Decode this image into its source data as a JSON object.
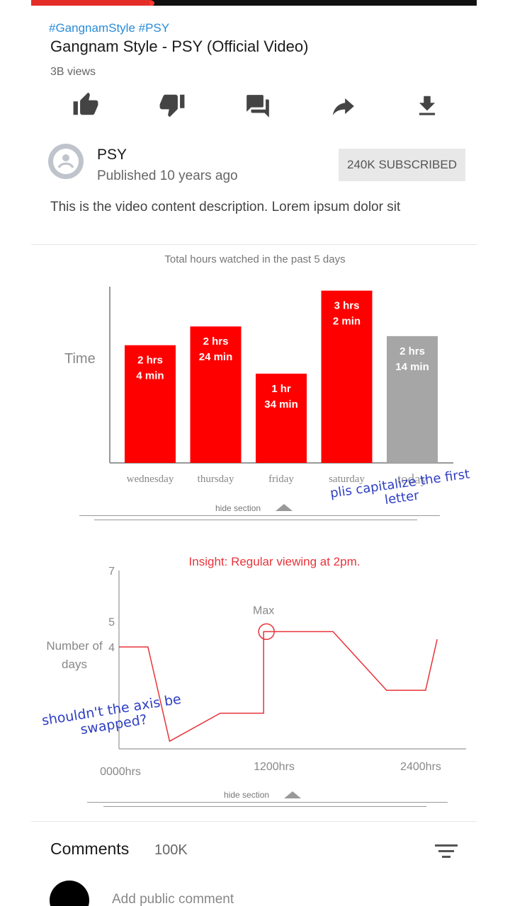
{
  "player": {
    "progress": 0.27,
    "accent": "#e52d27"
  },
  "video": {
    "hashtags": "#GangnamStyle #PSY",
    "title": "Gangnam Style - PSY (Official Video)",
    "views": "3B views",
    "description": "This is the video content description. Lorem ipsum dolor sit"
  },
  "actions": [
    {
      "name": "like-icon"
    },
    {
      "name": "dislike-icon"
    },
    {
      "name": "comment-icon"
    },
    {
      "name": "share-icon"
    },
    {
      "name": "download-icon"
    }
  ],
  "channel": {
    "name": "PSY",
    "published": "Published 10 years ago",
    "subscribe_label": "240K SUBSCRIBED"
  },
  "chart_data": [
    {
      "type": "bar",
      "title": "Total hours watched in the past 5 days",
      "ylabel": "Time",
      "categories": [
        "wednesday",
        "thursday",
        "friday",
        "saturday",
        "today"
      ],
      "values": [
        2.07,
        2.4,
        1.57,
        3.03,
        2.23
      ],
      "value_labels": [
        [
          "2 hrs",
          "4 min"
        ],
        [
          "2 hrs",
          "24 min"
        ],
        [
          "1 hr",
          "34 min"
        ],
        [
          "3 hrs",
          "2 min"
        ],
        [
          "2 hrs",
          "14 min"
        ]
      ],
      "colors": [
        "#ff0000",
        "#ff0000",
        "#ff0000",
        "#ff0000",
        "#a6a6a6"
      ],
      "ylim": [
        0,
        3.1
      ]
    },
    {
      "type": "line",
      "title": "Insight: Regular viewing at 2pm.",
      "ylabel": "Number of days",
      "yticks": [
        4,
        5,
        7
      ],
      "ylim": [
        0,
        7
      ],
      "xticks": [
        "0000hrs",
        "1200hrs",
        "2400hrs"
      ],
      "x": [
        0,
        2,
        3.5,
        7,
        10,
        10,
        13,
        14.8,
        18.5,
        21.2,
        22
      ],
      "y": [
        4,
        4,
        0.3,
        1.4,
        1.4,
        4.6,
        4.6,
        4.6,
        2.3,
        2.3,
        4.3
      ],
      "xlim": [
        0,
        24
      ],
      "max_label": "Max",
      "color": "#e8333a"
    }
  ],
  "sections": {
    "hide_label": "hide section"
  },
  "annotations": {
    "bar": "plis capitalize the first letter",
    "line": "shouldn't the axis be swapped?"
  },
  "comments": {
    "title": "Comments",
    "count": "100K",
    "placeholder": "Add public comment"
  }
}
